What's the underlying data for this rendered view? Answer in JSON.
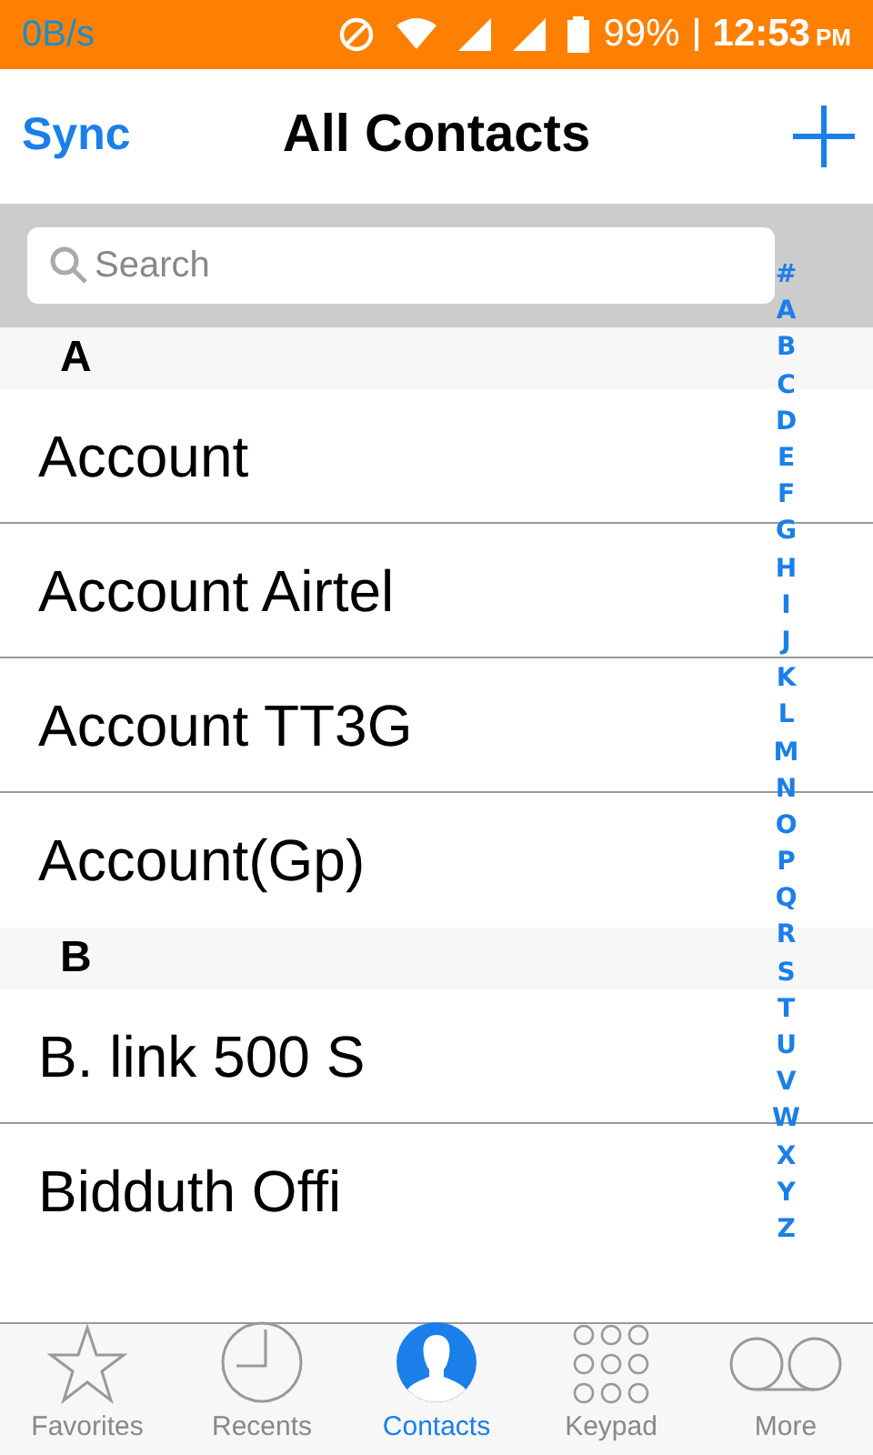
{
  "status_bar": {
    "speed": "0B/s",
    "battery": "99%",
    "time": "12:53",
    "ampm": "PM"
  },
  "header": {
    "left": "Sync",
    "title": "All Contacts"
  },
  "search": {
    "placeholder": "Search"
  },
  "sections": [
    {
      "letter": "A",
      "contacts": [
        "Account",
        "Account Airtel",
        "Account TT3G",
        "Account(Gp)"
      ]
    },
    {
      "letter": "B",
      "contacts": [
        "B. link 500 S",
        "Bidduth Offi"
      ]
    }
  ],
  "index": [
    "#",
    "A",
    "B",
    "C",
    "D",
    "E",
    "F",
    "G",
    "H",
    "I",
    "J",
    "K",
    "L",
    "M",
    "N",
    "O",
    "P",
    "Q",
    "R",
    "S",
    "T",
    "U",
    "V",
    "W",
    "X",
    "Y",
    "Z"
  ],
  "tabs": [
    {
      "label": "Favorites",
      "kind": "star",
      "selected": false
    },
    {
      "label": "Recents",
      "kind": "clock",
      "selected": false
    },
    {
      "label": "Contacts",
      "kind": "person",
      "selected": true
    },
    {
      "label": "Keypad",
      "kind": "keypad",
      "selected": false
    },
    {
      "label": "More",
      "kind": "voicemail",
      "selected": false
    }
  ]
}
